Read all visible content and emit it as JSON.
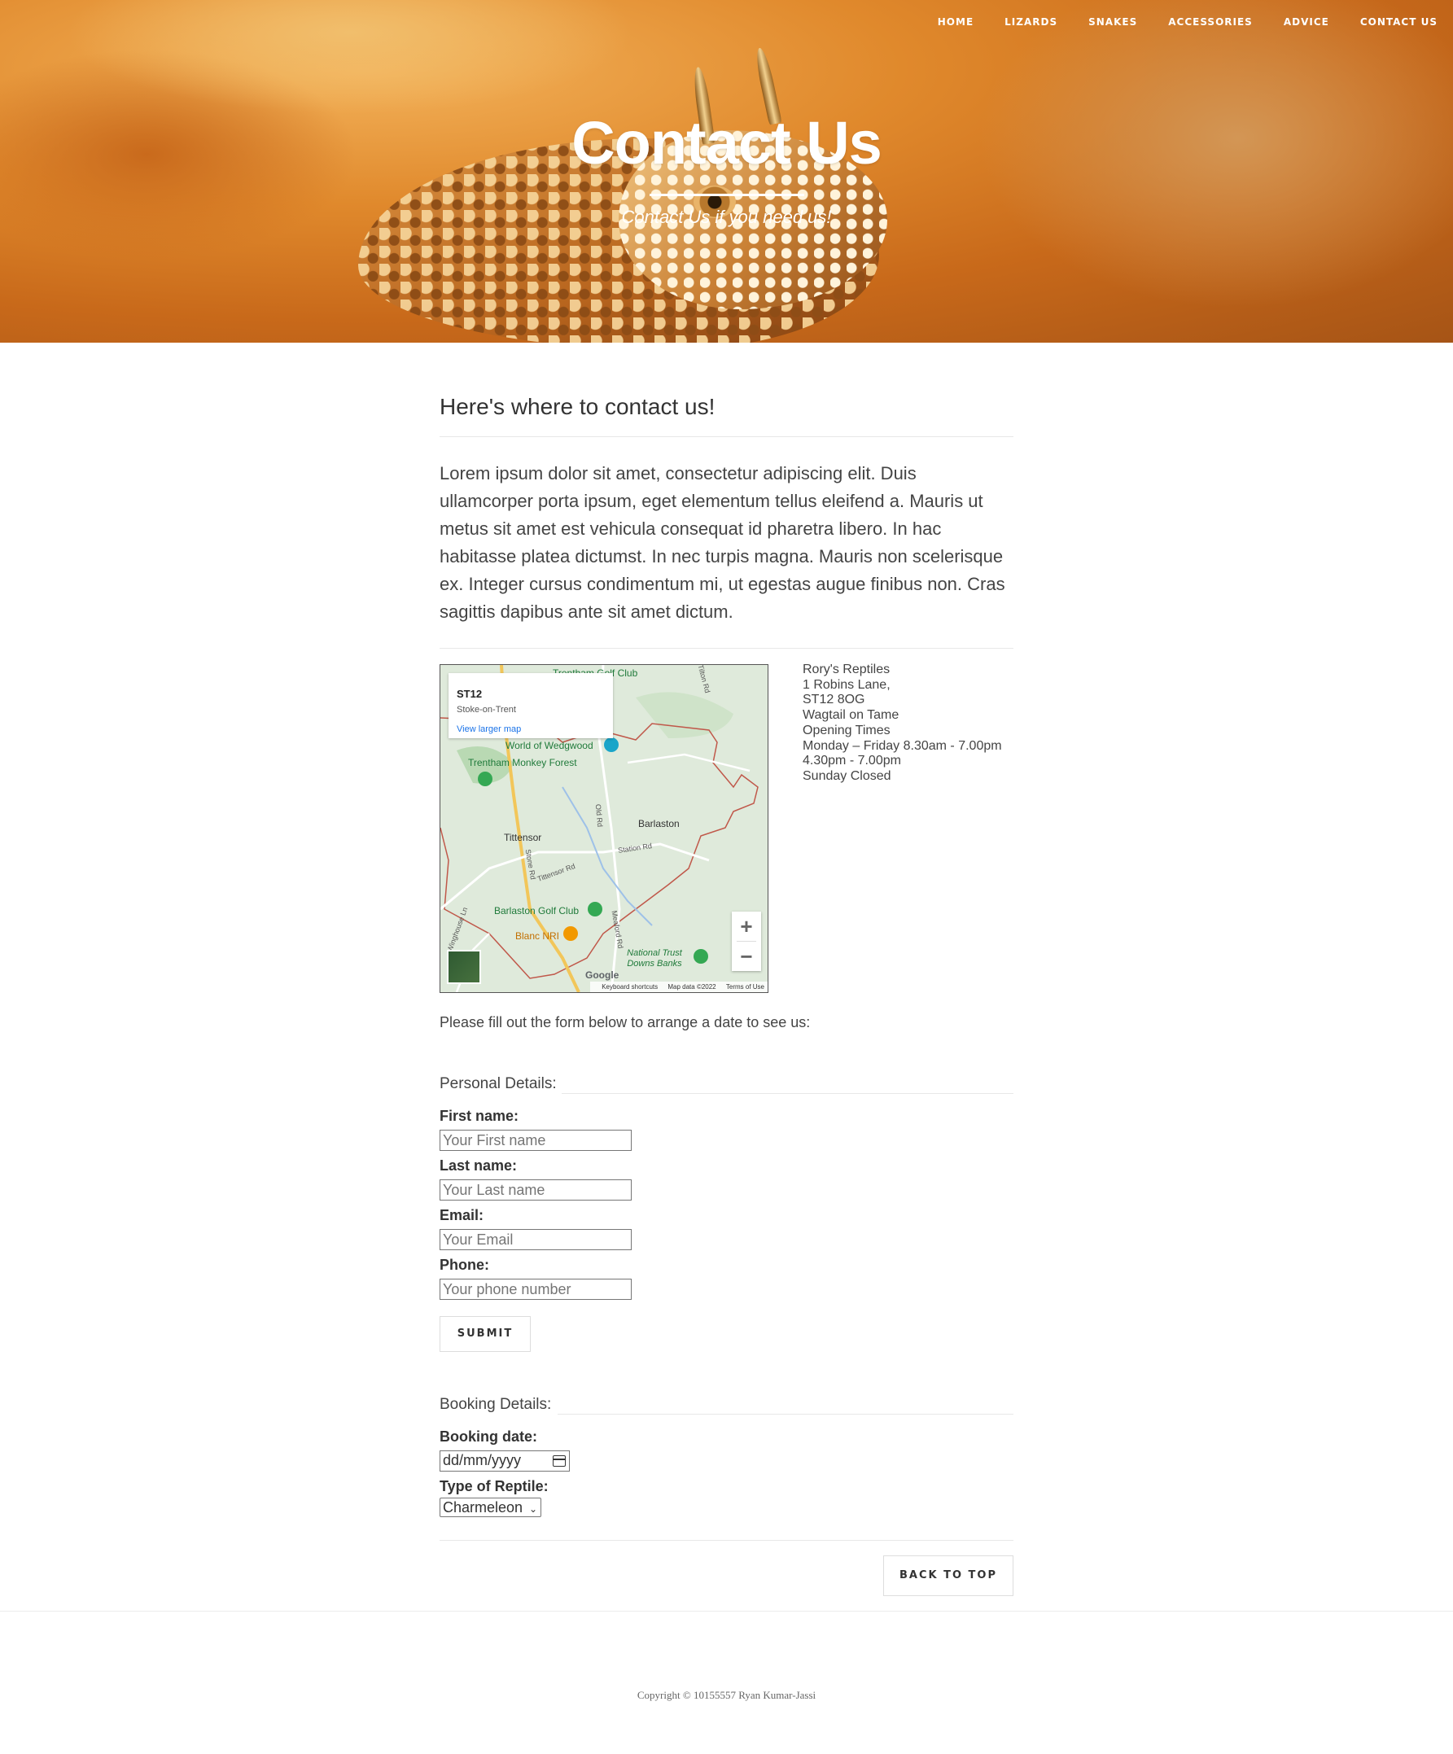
{
  "nav": {
    "items": [
      "HOME",
      "LIZARDS",
      "SNAKES",
      "ACCESSORIES",
      "ADVICE",
      "CONTACT US"
    ]
  },
  "hero": {
    "title": "Contact Us",
    "subtitle": "Contact Us if you need us!"
  },
  "section": {
    "heading": "Here's where to contact us!",
    "lead": "Lorem ipsum dolor sit amet, consectetur adipiscing elit. Duis ullamcorper porta ipsum, eget elementum tellus eleifend a. Mauris ut metus sit amet est vehicula consequat id pharetra libero. In hac habitasse platea dictumst. In nec turpis magna. Mauris non scelerisque ex. Integer cursus condimentum mi, ut egestas augue finibus non. Cras sagittis dapibus ante sit amet dictum."
  },
  "map": {
    "card_title": "ST12",
    "card_subtitle": "Stoke-on-Trent",
    "card_link": "View larger map",
    "labels": {
      "trentham_golf": "Trentham Golf Club",
      "world_wedgwood": "World of Wedgwood",
      "monkey_forest": "Trentham Monkey Forest",
      "tittensor": "Tittensor",
      "barlaston": "Barlaston",
      "barlaston_golf": "Barlaston Golf Club",
      "blanc": "Blanc NRI",
      "national_trust": "National Trust Downs Banks",
      "station_rd": "Station Rd",
      "tittensor_rd": "Tittensor Rd",
      "stone_rd": "Stone Rd",
      "old_rd": "Old Rd",
      "meaford_rd": "Meaford Rd",
      "winghouse": "Winghouse Ln",
      "tilton_rd": "Tilton Rd"
    },
    "zoom_in": "+",
    "zoom_out": "−",
    "google": "Google",
    "footer": [
      "Keyboard shortcuts",
      "Map data ©2022",
      "Terms of Use"
    ]
  },
  "address": [
    "Rory's Reptiles",
    "1 Robins Lane,",
    "ST12 8OG",
    "Wagtail on Tame",
    "Opening Times",
    "Monday – Friday 8.30am - 7.00pm",
    "4.30pm - 7.00pm",
    "Sunday Closed"
  ],
  "form": {
    "intro": "Please fill out the form below to arrange a date to see us:",
    "personal_legend": "Personal Details:",
    "first_name_label": "First name:",
    "first_name_placeholder": "Your First name",
    "last_name_label": "Last name:",
    "last_name_placeholder": "Your Last name",
    "email_label": "Email:",
    "email_placeholder": "Your Email",
    "phone_label": "Phone:",
    "phone_placeholder": "Your phone number",
    "submit": "SUBMIT",
    "booking_legend": "Booking Details:",
    "booking_date_label": "Booking date:",
    "booking_date_value": "dd/mm/yyyy",
    "reptile_label": "Type of Reptile:",
    "reptile_selected": "Charmeleon"
  },
  "back_to_top": "BACK TO TOP",
  "footer": {
    "copyright": "Copyright © 10155557 Ryan Kumar-Jassi"
  }
}
